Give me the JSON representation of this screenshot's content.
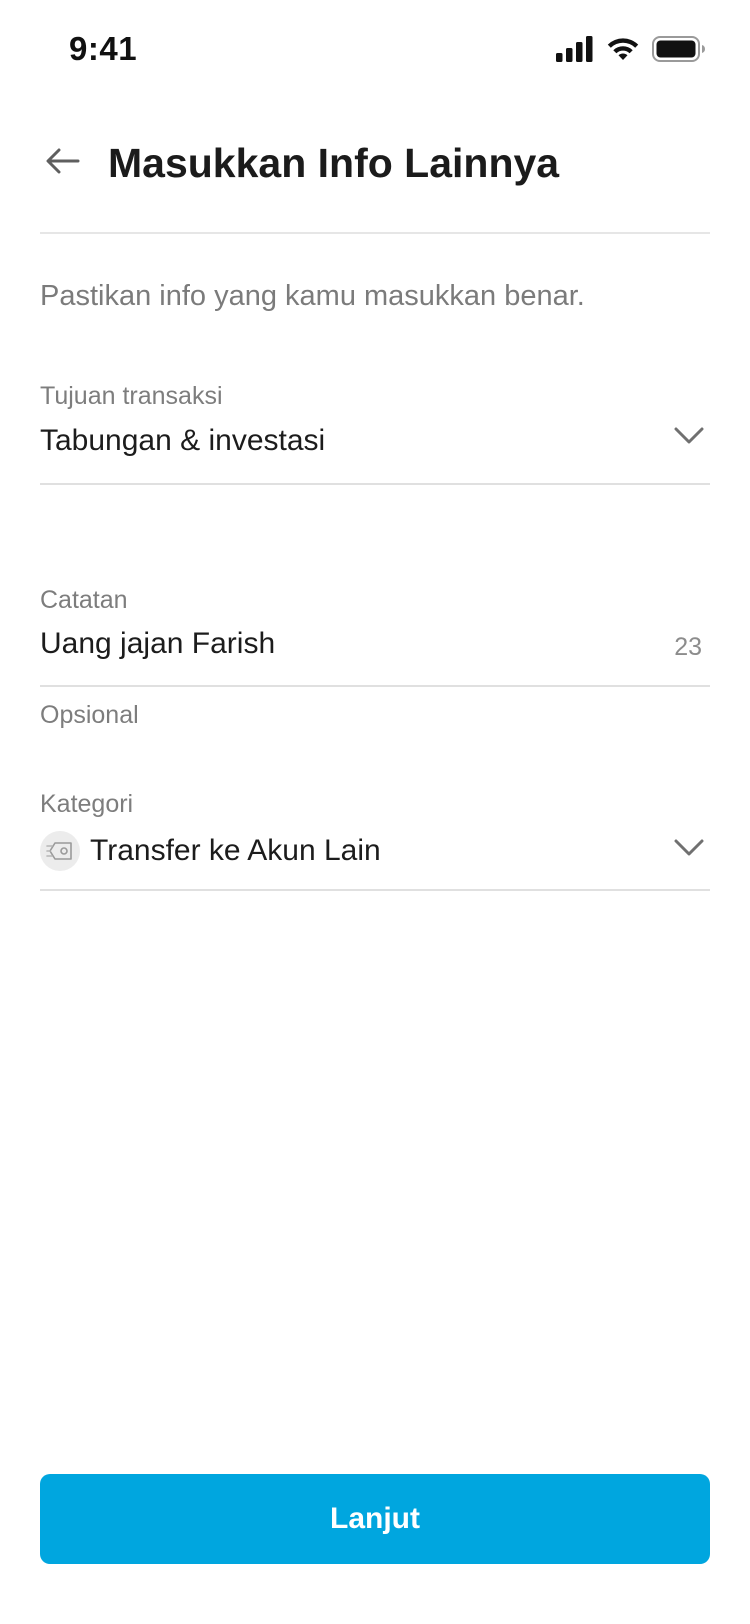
{
  "status_bar": {
    "time": "9:41",
    "icons": [
      "cellular-signal-icon",
      "wifi-icon",
      "battery-icon"
    ]
  },
  "header": {
    "back_icon": "arrow-left-icon",
    "title": "Masukkan Info Lainnya"
  },
  "subtitle": "Pastikan info yang kamu masukkan benar.",
  "fields": {
    "purpose": {
      "label": "Tujuan transaksi",
      "value": "Tabungan & investasi",
      "icon": "chevron-down-icon"
    },
    "note": {
      "label": "Catatan",
      "value": "Uang jajan Farish",
      "counter": "23",
      "helper": "Opsional"
    },
    "category": {
      "label": "Kategori",
      "value": "Transfer ke Akun Lain",
      "icon": "transfer-tag-icon",
      "dropdown_icon": "chevron-down-icon"
    }
  },
  "cta": {
    "label": "Lanjut",
    "color": "#00A6DF"
  },
  "colors": {
    "accent": "#00A6DF",
    "text_primary": "#1C1C1C",
    "text_secondary": "#7D7D7D",
    "divider": "#E0E0E0"
  }
}
